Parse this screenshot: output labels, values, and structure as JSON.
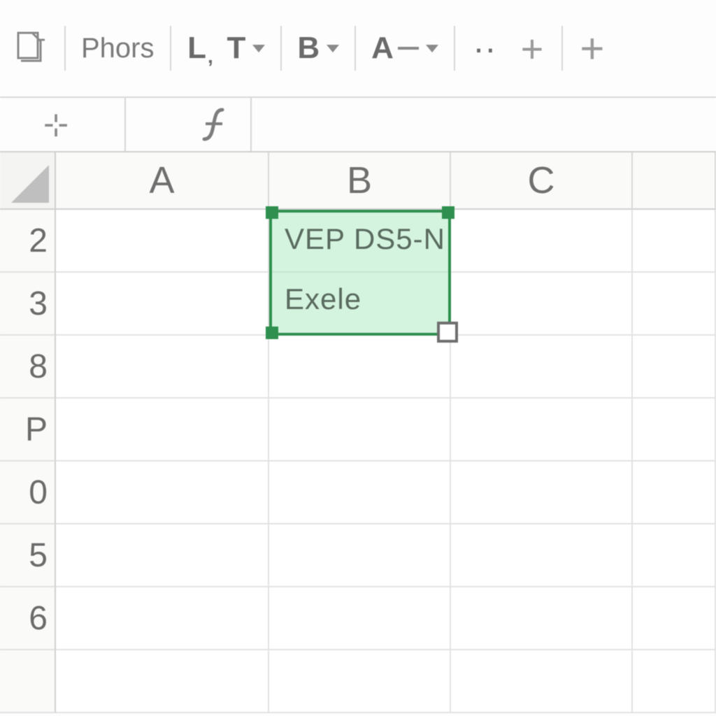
{
  "toolbar": {
    "font_label": "Phors",
    "l_btn": "L",
    "t_btn": "T",
    "b_btn": "B",
    "a_btn": "A",
    "dots": "··",
    "plus": "+"
  },
  "formula_bar": {
    "name_box": "",
    "fx_symbol": "ƒ",
    "formula": ""
  },
  "columns": [
    "A",
    "B",
    "C",
    ""
  ],
  "rows": [
    "2",
    "3",
    "8",
    "P",
    "0",
    "5",
    "6",
    ""
  ],
  "selection": {
    "range": "B2:B3",
    "line1": "VEP DS5-N",
    "line2": "Exele"
  }
}
